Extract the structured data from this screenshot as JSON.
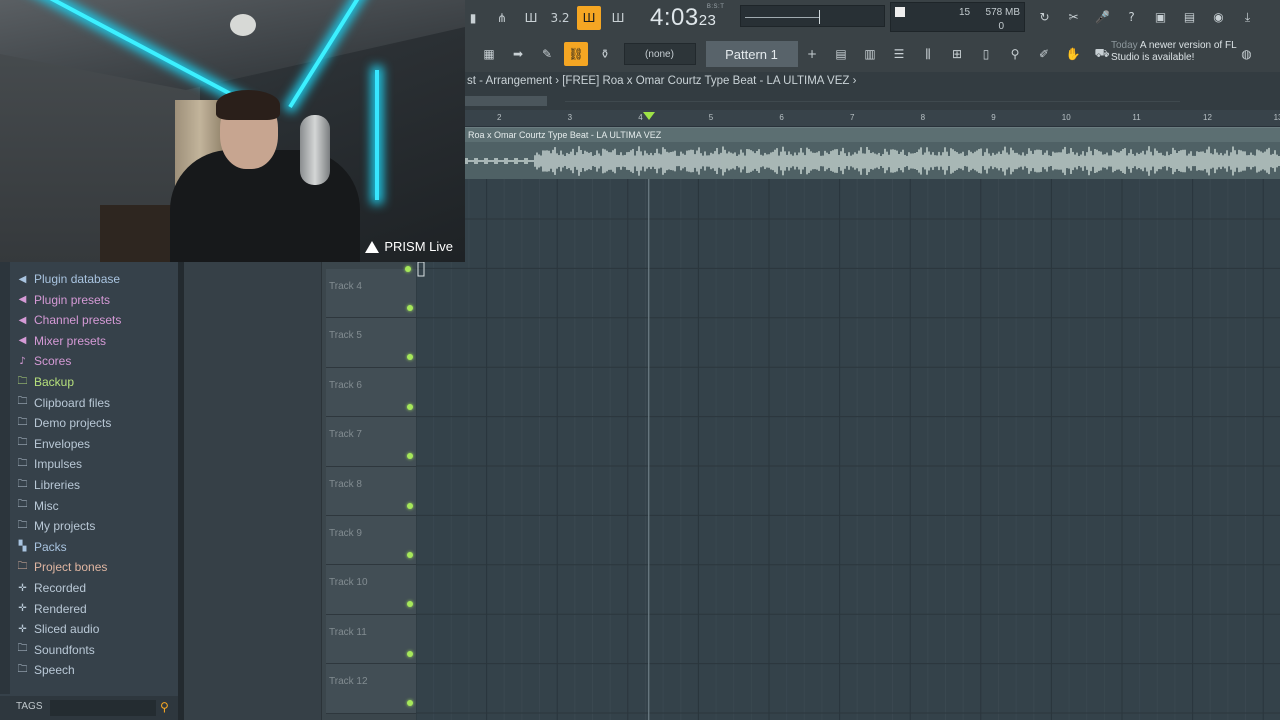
{
  "overlay": {
    "brand": "PRISM Live"
  },
  "transport": {
    "time_main": "4:03",
    "time_sub": "23",
    "time_bst": "B:S:T"
  },
  "cpu": {
    "value1": "15",
    "memory": "578 MB",
    "value3": "0"
  },
  "toolbar": {
    "row1_icons": [
      "tempo-icon",
      "metronome-icon",
      "step-icon",
      "count-icon",
      "blend-notes-icon",
      "loop-record-icon"
    ],
    "pattern_selector": "(none)",
    "pattern_name": "Pattern 1",
    "hint_today": "Today",
    "hint_text": "A newer version of FL Studio is available!"
  },
  "breadcrumb": "st - Arrangement › [FREE] Roa x Omar Courtz Type Beat  - LA ULTIMA VEZ ›",
  "ruler": {
    "bars": [
      "2",
      "3",
      "4",
      "5",
      "6",
      "7",
      "8",
      "9",
      "10",
      "11",
      "12",
      "13"
    ],
    "playhead_bar": 4.15
  },
  "audio_clip": {
    "title": "Roa x Omar Courtz Type Beat  - LA ULTIMA VEZ"
  },
  "browser": {
    "items": [
      {
        "label": "Plugin database",
        "icon": "plugin-icon",
        "glyph": "◀",
        "color": "#a9c4e0"
      },
      {
        "label": "Plugin presets",
        "icon": "plugin-icon",
        "glyph": "◀",
        "color": "#d59ad6"
      },
      {
        "label": "Channel presets",
        "icon": "plugin-icon",
        "glyph": "◀",
        "color": "#d59ad6"
      },
      {
        "label": "Mixer presets",
        "icon": "plugin-icon",
        "glyph": "◀",
        "color": "#d59ad6"
      },
      {
        "label": "Scores",
        "icon": "note-icon",
        "glyph": "♪",
        "color": "#d59ad6"
      },
      {
        "label": "Backup",
        "icon": "folder-icon",
        "glyph": "🗀",
        "color": "#b6e07c"
      },
      {
        "label": "Clipboard files",
        "icon": "folder-icon",
        "glyph": "🗀",
        "color": "#b9c8d6"
      },
      {
        "label": "Demo projects",
        "icon": "folder-icon",
        "glyph": "🗀",
        "color": "#b9c8d6"
      },
      {
        "label": "Envelopes",
        "icon": "folder-icon",
        "glyph": "🗀",
        "color": "#b9c8d6"
      },
      {
        "label": "Impulses",
        "icon": "folder-icon",
        "glyph": "🗀",
        "color": "#b9c8d6"
      },
      {
        "label": "Libreries",
        "icon": "folder-icon",
        "glyph": "🗀",
        "color": "#b9c8d6"
      },
      {
        "label": "Misc",
        "icon": "folder-icon",
        "glyph": "🗀",
        "color": "#b9c8d6"
      },
      {
        "label": "My projects",
        "icon": "folder-icon",
        "glyph": "🗀",
        "color": "#b9c8d6"
      },
      {
        "label": "Packs",
        "icon": "packs-icon",
        "glyph": "▚",
        "color": "#a9c4e0"
      },
      {
        "label": "Project bones",
        "icon": "folder-icon",
        "glyph": "🗀",
        "color": "#e0b6a2"
      },
      {
        "label": "Recorded",
        "icon": "record-icon",
        "glyph": "✛",
        "color": "#b9c8d6"
      },
      {
        "label": "Rendered",
        "icon": "render-icon",
        "glyph": "✛",
        "color": "#b9c8d6"
      },
      {
        "label": "Sliced audio",
        "icon": "slice-icon",
        "glyph": "✛",
        "color": "#b9c8d6"
      },
      {
        "label": "Soundfonts",
        "icon": "folder-icon",
        "glyph": "🗀",
        "color": "#b9c8d6"
      },
      {
        "label": "Speech",
        "icon": "folder-icon",
        "glyph": "🗀",
        "color": "#b9c8d6"
      }
    ],
    "tags_label": "TAGS"
  },
  "tracks": [
    {
      "name": "Track 4"
    },
    {
      "name": "Track 5"
    },
    {
      "name": "Track 6"
    },
    {
      "name": "Track 7"
    },
    {
      "name": "Track 8"
    },
    {
      "name": "Track 9"
    },
    {
      "name": "Track 10"
    },
    {
      "name": "Track 11"
    },
    {
      "name": "Track 12"
    }
  ],
  "colors": {
    "accent": "#f5a623",
    "led": "#a6e85a",
    "playhead": "#9ee346"
  }
}
